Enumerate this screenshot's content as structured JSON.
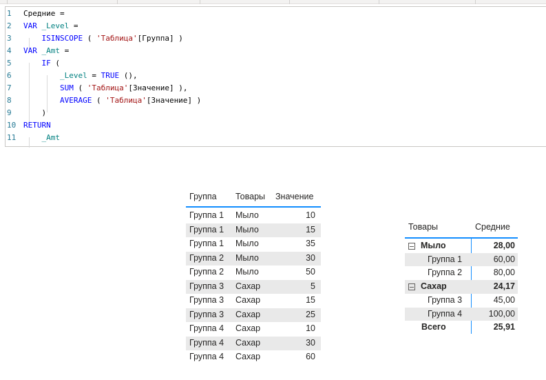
{
  "editor": {
    "lines": [
      {
        "n": "1",
        "tokens": [
          [
            "plain",
            "Средние ="
          ]
        ]
      },
      {
        "n": "2",
        "tokens": [
          [
            "kw",
            "VAR "
          ],
          [
            "var",
            "_Level"
          ],
          [
            "plain",
            " ="
          ]
        ]
      },
      {
        "n": "3",
        "tokens": [
          [
            "plain",
            "    "
          ],
          [
            "kw",
            "ISINSCOPE"
          ],
          [
            "plain",
            " ( "
          ],
          [
            "str",
            "'Таблица'"
          ],
          [
            "plain",
            "[Группа] )"
          ]
        ]
      },
      {
        "n": "4",
        "tokens": [
          [
            "kw",
            "VAR "
          ],
          [
            "var",
            "_Amt"
          ],
          [
            "plain",
            " ="
          ]
        ]
      },
      {
        "n": "5",
        "tokens": [
          [
            "plain",
            "    "
          ],
          [
            "kw",
            "IF"
          ],
          [
            "plain",
            " ("
          ]
        ]
      },
      {
        "n": "6",
        "tokens": [
          [
            "plain",
            "        "
          ],
          [
            "var",
            "_Level"
          ],
          [
            "plain",
            " = "
          ],
          [
            "kw",
            "TRUE"
          ],
          [
            "plain",
            " (),"
          ]
        ]
      },
      {
        "n": "7",
        "tokens": [
          [
            "plain",
            "        "
          ],
          [
            "kw",
            "SUM"
          ],
          [
            "plain",
            " ( "
          ],
          [
            "str",
            "'Таблица'"
          ],
          [
            "plain",
            "[Значение] ),"
          ]
        ]
      },
      {
        "n": "8",
        "tokens": [
          [
            "plain",
            "        "
          ],
          [
            "kw",
            "AVERAGE"
          ],
          [
            "plain",
            " ( "
          ],
          [
            "str",
            "'Таблица'"
          ],
          [
            "plain",
            "[Значение] )"
          ]
        ]
      },
      {
        "n": "9",
        "tokens": [
          [
            "plain",
            "    )"
          ]
        ]
      },
      {
        "n": "10",
        "tokens": [
          [
            "kw",
            "RETURN"
          ]
        ]
      },
      {
        "n": "11",
        "tokens": [
          [
            "plain",
            "    "
          ],
          [
            "var",
            "_Amt"
          ]
        ]
      }
    ]
  },
  "table": {
    "headers": [
      "Группа",
      "Товары",
      "Значение"
    ],
    "rows": [
      [
        "Группа 1",
        "Мыло",
        "10"
      ],
      [
        "Группа 1",
        "Мыло",
        "15"
      ],
      [
        "Группа 1",
        "Мыло",
        "35"
      ],
      [
        "Группа 2",
        "Мыло",
        "30"
      ],
      [
        "Группа 2",
        "Мыло",
        "50"
      ],
      [
        "Группа 3",
        "Сахар",
        "5"
      ],
      [
        "Группа 3",
        "Сахар",
        "15"
      ],
      [
        "Группа 3",
        "Сахар",
        "25"
      ],
      [
        "Группа 4",
        "Сахар",
        "10"
      ],
      [
        "Группа 4",
        "Сахар",
        "30"
      ],
      [
        "Группа 4",
        "Сахар",
        "60"
      ]
    ]
  },
  "matrix": {
    "headers": [
      "Товары",
      "Средние"
    ],
    "rows": [
      {
        "level": 0,
        "label": "Мыло",
        "value": "28,00",
        "alt": false
      },
      {
        "level": 1,
        "label": "Группа 1",
        "value": "60,00",
        "alt": true
      },
      {
        "level": 1,
        "label": "Группа 2",
        "value": "80,00",
        "alt": false
      },
      {
        "level": 0,
        "label": "Сахар",
        "value": "24,17",
        "alt": true
      },
      {
        "level": 1,
        "label": "Группа 3",
        "value": "45,00",
        "alt": false
      },
      {
        "level": 1,
        "label": "Группа 4",
        "value": "100,00",
        "alt": true
      },
      {
        "level": -1,
        "label": "Всего",
        "value": "25,91",
        "alt": false
      }
    ]
  },
  "colors": {
    "keyword": "#0000ff",
    "variable": "#008080",
    "string": "#a31515",
    "accent": "#118dff"
  }
}
